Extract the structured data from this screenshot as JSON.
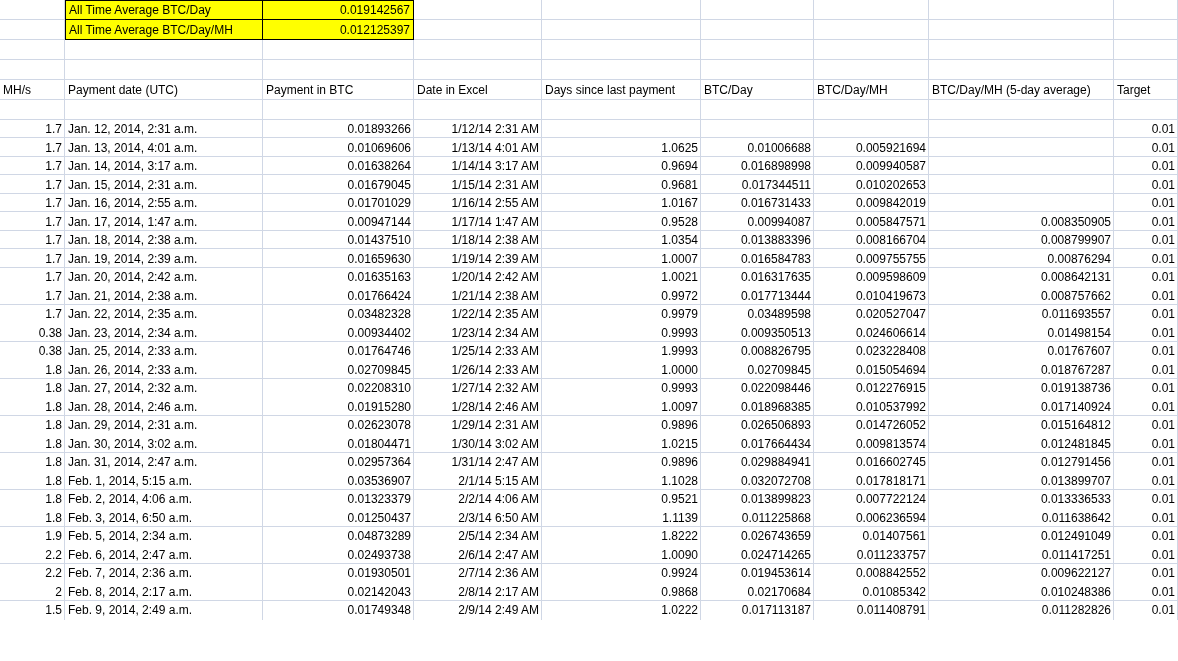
{
  "summary": [
    {
      "label": "All Time Average BTC/Day",
      "value": "0.019142567"
    },
    {
      "label": "All Time Average BTC/Day/MH",
      "value": "0.012125397"
    }
  ],
  "columns": [
    "MH/s",
    "Payment date (UTC)",
    "Payment in BTC",
    "Date in Excel",
    "Days since last payment",
    "BTC/Day",
    "BTC/Day/MH",
    "BTC/Day/MH (5-day average)",
    "Target"
  ],
  "rows": [
    {
      "mh_s": "1.7",
      "payment_date": "Jan. 12, 2014, 2:31 a.m.",
      "payment_btc": "0.01893266",
      "date_excel": "1/12/14 2:31 AM",
      "target": "0.01"
    },
    {
      "mh_s": "1.7",
      "payment_date": "Jan. 13, 2014, 4:01 a.m.",
      "payment_btc": "0.01069606",
      "date_excel": "1/13/14 4:01 AM",
      "days_since": "1.0625",
      "btc_day": "0.01006688",
      "btc_day_mh": "0.005921694",
      "target": "0.01"
    },
    {
      "mh_s": "1.7",
      "payment_date": "Jan. 14, 2014, 3:17 a.m.",
      "payment_btc": "0.01638264",
      "date_excel": "1/14/14 3:17 AM",
      "days_since": "0.9694",
      "btc_day": "0.016898998",
      "btc_day_mh": "0.009940587",
      "target": "0.01"
    },
    {
      "mh_s": "1.7",
      "payment_date": "Jan. 15, 2014, 2:31 a.m.",
      "payment_btc": "0.01679045",
      "date_excel": "1/15/14 2:31 AM",
      "days_since": "0.9681",
      "btc_day": "0.017344511",
      "btc_day_mh": "0.010202653",
      "target": "0.01"
    },
    {
      "mh_s": "1.7",
      "payment_date": "Jan. 16, 2014, 2:55 a.m.",
      "payment_btc": "0.01701029",
      "date_excel": "1/16/14 2:55 AM",
      "days_since": "1.0167",
      "btc_day": "0.016731433",
      "btc_day_mh": "0.009842019",
      "target": "0.01"
    },
    {
      "mh_s": "1.7",
      "payment_date": "Jan. 17, 2014, 1:47 a.m.",
      "payment_btc": "0.00947144",
      "date_excel": "1/17/14 1:47 AM",
      "days_since": "0.9528",
      "btc_day": "0.00994087",
      "btc_day_mh": "0.005847571",
      "avg_5day": "0.008350905",
      "target": "0.01"
    },
    {
      "mh_s": "1.7",
      "payment_date": "Jan. 18, 2014, 2:38 a.m.",
      "payment_btc": "0.01437510",
      "date_excel": "1/18/14 2:38 AM",
      "days_since": "1.0354",
      "btc_day": "0.013883396",
      "btc_day_mh": "0.008166704",
      "avg_5day": "0.008799907",
      "target": "0.01"
    },
    {
      "mh_s": "1.7",
      "payment_date": "Jan. 19, 2014, 2:39 a.m.",
      "payment_btc": "0.01659630",
      "date_excel": "1/19/14 2:39 AM",
      "days_since": "1.0007",
      "btc_day": "0.016584783",
      "btc_day_mh": "0.009755755",
      "avg_5day": "0.00876294",
      "target": "0.01"
    },
    {
      "mh_s": "1.7",
      "payment_date": "Jan. 20, 2014, 2:42 a.m.",
      "payment_btc": "0.01635163",
      "date_excel": "1/20/14 2:42 AM",
      "days_since": "1.0021",
      "btc_day": "0.016317635",
      "btc_day_mh": "0.009598609",
      "avg_5day": "0.008642131",
      "target": "0.01"
    },
    {
      "mh_s": "1.7",
      "payment_date": "Jan. 21, 2014, 2:38 a.m.",
      "payment_btc": "0.01766424",
      "date_excel": "1/21/14 2:38 AM",
      "days_since": "0.9972",
      "btc_day": "0.017713444",
      "btc_day_mh": "0.010419673",
      "avg_5day": "0.008757662",
      "target": "0.01"
    },
    {
      "mh_s": "1.7",
      "payment_date": "Jan. 22, 2014, 2:35 a.m.",
      "payment_btc": "0.03482328",
      "date_excel": "1/22/14 2:35 AM",
      "days_since": "0.9979",
      "btc_day": "0.03489598",
      "btc_day_mh": "0.020527047",
      "avg_5day": "0.011693557",
      "target": "0.01"
    },
    {
      "mh_s": "0.38",
      "payment_date": "Jan. 23, 2014, 2:34 a.m.",
      "payment_btc": "0.00934402",
      "date_excel": "1/23/14 2:34 AM",
      "days_since": "0.9993",
      "btc_day": "0.009350513",
      "btc_day_mh": "0.024606614",
      "avg_5day": "0.01498154",
      "target": "0.01"
    },
    {
      "mh_s": "0.38",
      "payment_date": "Jan. 25, 2014, 2:33 a.m.",
      "payment_btc": "0.01764746",
      "date_excel": "1/25/14 2:33 AM",
      "days_since": "1.9993",
      "btc_day": "0.008826795",
      "btc_day_mh": "0.023228408",
      "avg_5day": "0.01767607",
      "target": "0.01"
    },
    {
      "mh_s": "1.8",
      "payment_date": "Jan. 26, 2014, 2:33 a.m.",
      "payment_btc": "0.02709845",
      "date_excel": "1/26/14 2:33 AM",
      "days_since": "1.0000",
      "btc_day": "0.02709845",
      "btc_day_mh": "0.015054694",
      "avg_5day": "0.018767287",
      "target": "0.01"
    },
    {
      "mh_s": "1.8",
      "payment_date": "Jan. 27, 2014, 2:32 a.m.",
      "payment_btc": "0.02208310",
      "date_excel": "1/27/14 2:32 AM",
      "days_since": "0.9993",
      "btc_day": "0.022098446",
      "btc_day_mh": "0.012276915",
      "avg_5day": "0.019138736",
      "target": "0.01"
    },
    {
      "mh_s": "1.8",
      "payment_date": "Jan. 28, 2014, 2:46 a.m.",
      "payment_btc": "0.01915280",
      "date_excel": "1/28/14 2:46 AM",
      "days_since": "1.0097",
      "btc_day": "0.018968385",
      "btc_day_mh": "0.010537992",
      "avg_5day": "0.017140924",
      "target": "0.01"
    },
    {
      "mh_s": "1.8",
      "payment_date": "Jan. 29, 2014, 2:31 a.m.",
      "payment_btc": "0.02623078",
      "date_excel": "1/29/14 2:31 AM",
      "days_since": "0.9896",
      "btc_day": "0.026506893",
      "btc_day_mh": "0.014726052",
      "avg_5day": "0.015164812",
      "target": "0.01"
    },
    {
      "mh_s": "1.8",
      "payment_date": "Jan. 30, 2014, 3:02 a.m.",
      "payment_btc": "0.01804471",
      "date_excel": "1/30/14 3:02 AM",
      "days_since": "1.0215",
      "btc_day": "0.017664434",
      "btc_day_mh": "0.009813574",
      "avg_5day": "0.012481845",
      "target": "0.01"
    },
    {
      "mh_s": "1.8",
      "payment_date": "Jan. 31, 2014, 2:47 a.m.",
      "payment_btc": "0.02957364",
      "date_excel": "1/31/14 2:47 AM",
      "days_since": "0.9896",
      "btc_day": "0.029884941",
      "btc_day_mh": "0.016602745",
      "avg_5day": "0.012791456",
      "target": "0.01"
    },
    {
      "mh_s": "1.8",
      "payment_date": "Feb. 1, 2014, 5:15 a.m.",
      "payment_btc": "0.03536907",
      "date_excel": "2/1/14 5:15 AM",
      "days_since": "1.1028",
      "btc_day": "0.032072708",
      "btc_day_mh": "0.017818171",
      "avg_5day": "0.013899707",
      "target": "0.01"
    },
    {
      "mh_s": "1.8",
      "payment_date": "Feb. 2, 2014, 4:06 a.m.",
      "payment_btc": "0.01323379",
      "date_excel": "2/2/14 4:06 AM",
      "days_since": "0.9521",
      "btc_day": "0.013899823",
      "btc_day_mh": "0.007722124",
      "avg_5day": "0.013336533",
      "target": "0.01"
    },
    {
      "mh_s": "1.8",
      "payment_date": "Feb. 3, 2014, 6:50 a.m.",
      "payment_btc": "0.01250437",
      "date_excel": "2/3/14 6:50 AM",
      "days_since": "1.1139",
      "btc_day": "0.011225868",
      "btc_day_mh": "0.006236594",
      "avg_5day": "0.011638642",
      "target": "0.01"
    },
    {
      "mh_s": "1.9",
      "payment_date": "Feb. 5, 2014, 2:34 a.m.",
      "payment_btc": "0.04873289",
      "date_excel": "2/5/14 2:34 AM",
      "days_since": "1.8222",
      "btc_day": "0.026743659",
      "btc_day_mh": "0.01407561",
      "avg_5day": "0.012491049",
      "target": "0.01"
    },
    {
      "mh_s": "2.2",
      "payment_date": "Feb. 6, 2014, 2:47 a.m.",
      "payment_btc": "0.02493738",
      "date_excel": "2/6/14 2:47 AM",
      "days_since": "1.0090",
      "btc_day": "0.024714265",
      "btc_day_mh": "0.011233757",
      "avg_5day": "0.011417251",
      "target": "0.01"
    },
    {
      "mh_s": "2.2",
      "payment_date": "Feb. 7, 2014, 2:36 a.m.",
      "payment_btc": "0.01930501",
      "date_excel": "2/7/14 2:36 AM",
      "days_since": "0.9924",
      "btc_day": "0.019453614",
      "btc_day_mh": "0.008842552",
      "avg_5day": "0.009622127",
      "target": "0.01"
    },
    {
      "mh_s": "2",
      "payment_date": "Feb. 8, 2014, 2:17 a.m.",
      "payment_btc": "0.02142043",
      "date_excel": "2/8/14 2:17 AM",
      "days_since": "0.9868",
      "btc_day": "0.02170684",
      "btc_day_mh": "0.01085342",
      "avg_5day": "0.010248386",
      "target": "0.01"
    },
    {
      "mh_s": "1.5",
      "payment_date": "Feb. 9, 2014, 2:49 a.m.",
      "payment_btc": "0.01749348",
      "date_excel": "2/9/14 2:49 AM",
      "days_since": "1.0222",
      "btc_day": "0.017113187",
      "btc_day_mh": "0.011408791",
      "avg_5day": "0.011282826",
      "target": "0.01"
    }
  ]
}
